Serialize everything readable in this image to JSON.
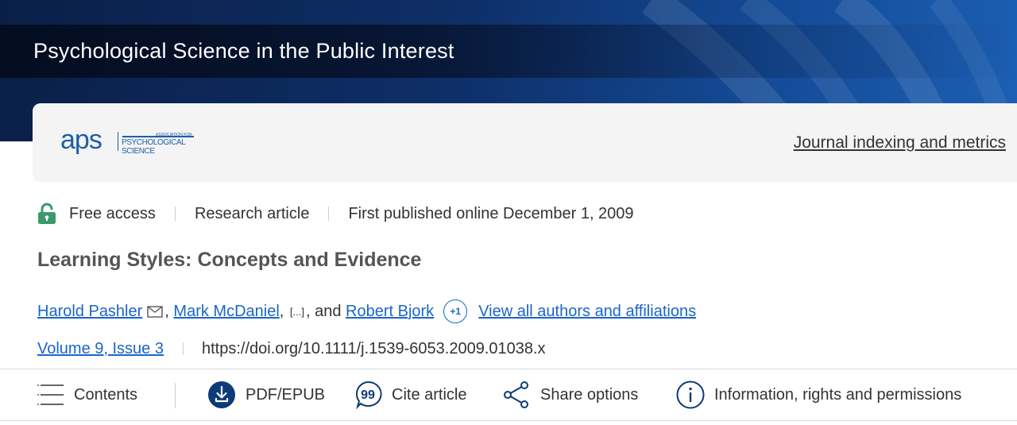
{
  "header": {
    "journal_title": "Psychological Science in the Public Interest"
  },
  "publisher": {
    "logo_text": "aps",
    "logo_small_top": "ASSOCIATION FOR",
    "logo_small_bottom": "PSYCHOLOGICAL SCIENCE",
    "indexing_link": "Journal indexing and metrics"
  },
  "meta": {
    "access": "Free access",
    "type": "Research article",
    "published": "First published online December 1, 2009"
  },
  "article": {
    "title": "Learning Styles: Concepts and Evidence",
    "authors": {
      "author1": "Harold Pashler",
      "author2": "Mark McDaniel",
      "ellipsis": "[...]",
      "conjunction": "and",
      "author3": "Robert Bjork",
      "more_count": "+1",
      "view_all": "View all authors and affiliations"
    },
    "volume_issue": "Volume 9, Issue 3",
    "doi": "https://doi.org/10.1111/j.1539-6053.2009.01038.x"
  },
  "toolbar": {
    "contents": "Contents",
    "pdf": "PDF/EPUB",
    "cite": "Cite article",
    "share": "Share options",
    "info": "Information, rights and permissions"
  },
  "colors": {
    "link": "#1a66c8",
    "header_dark": "#0a1f47",
    "header_blue": "#1c5fb4",
    "lock_green": "#3a9a6b"
  },
  "icons": [
    "lock-icon",
    "mail-icon",
    "menu-icon",
    "download-icon",
    "quote-icon",
    "share-icon",
    "info-icon"
  ]
}
